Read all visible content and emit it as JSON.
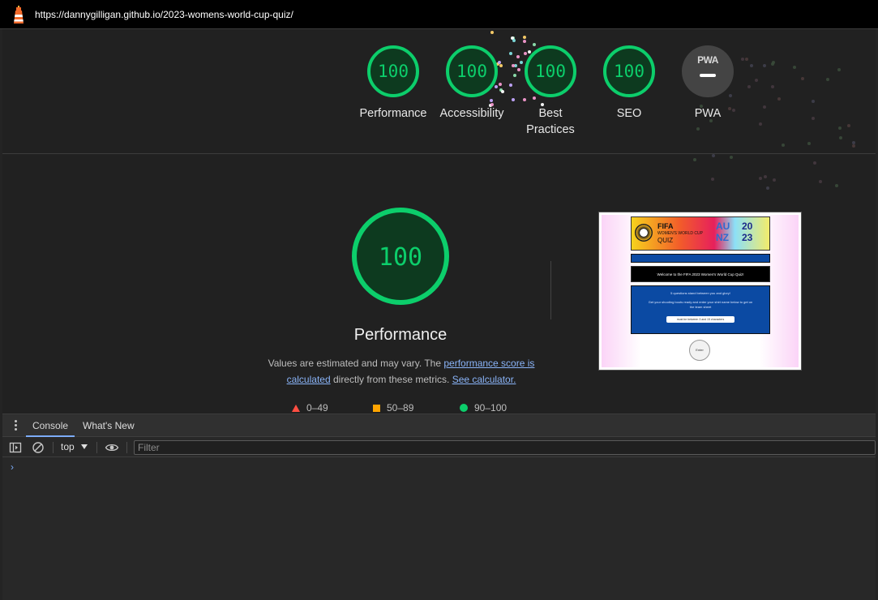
{
  "url_bar": {
    "url": "https://dannygilligan.github.io/2023-womens-world-cup-quiz/",
    "logo_icon": "lighthouse-icon"
  },
  "gauges": [
    {
      "score": "100",
      "label": "Performance"
    },
    {
      "score": "100",
      "label": "Accessibility"
    },
    {
      "score": "100",
      "label": "Best Practices"
    },
    {
      "score": "100",
      "label": "SEO"
    },
    {
      "badge": "PWA",
      "label": "PWA"
    }
  ],
  "performance": {
    "score": "100",
    "title": "Performance",
    "desc_text_1": "Values are estimated and may vary. The ",
    "desc_link_1": "performance score is calculated",
    "desc_text_2": " directly from these metrics. ",
    "desc_link_2": "See calculator."
  },
  "legend": [
    {
      "shape": "triangle",
      "range": "0–49",
      "color": "#ff4e42"
    },
    {
      "shape": "square",
      "range": "50–89",
      "color": "#ffa400"
    },
    {
      "shape": "circle",
      "range": "90–100",
      "color": "#0cce6b"
    }
  ],
  "thumbnail": {
    "banner_fifa": "FIFA",
    "banner_sub": "WOMEN'S WORLD CUP",
    "banner_quiz": "QUIZ",
    "banner_au": "AU\nNZ",
    "banner_year": "20\n23",
    "welcome": "Welcome to the FIFA 2023 Women's World Cup Quiz!",
    "intro_1": "5 questions stand between you and glory!",
    "intro_2": "Get your shooting boots ready and enter your shirt name below to get on the team sheet",
    "input_placeholder": "must be between 3 and 15 characters",
    "enter_button": "Enter"
  },
  "devtools": {
    "tabs": [
      "Console",
      "What's New"
    ],
    "active_tab": "Console",
    "context": "top",
    "filter_placeholder": "Filter",
    "prompt": "›"
  },
  "colors": {
    "pass": "#0cce6b",
    "average": "#ffa400",
    "fail": "#ff4e42",
    "link": "#8ab4f8"
  }
}
